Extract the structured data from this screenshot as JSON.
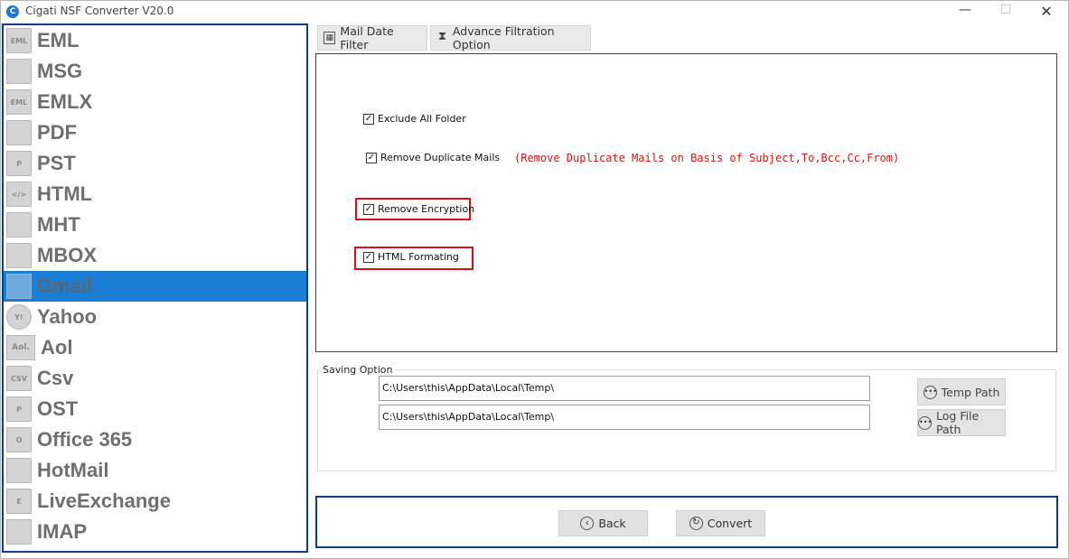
{
  "window": {
    "title": "Cigati NSF Converter V20.0",
    "app_icon_letter": "C",
    "minimize": "—",
    "maximize": "☐",
    "close": "✕"
  },
  "sidebar": {
    "selected_index": 8,
    "items": [
      {
        "label": "EML",
        "icon": "eml-file-icon",
        "glyph": "EML"
      },
      {
        "label": "MSG",
        "icon": "msg-envelope-icon",
        "glyph": ""
      },
      {
        "label": "EMLX",
        "icon": "emlx-file-icon",
        "glyph": "EML"
      },
      {
        "label": "PDF",
        "icon": "pdf-file-icon",
        "glyph": ""
      },
      {
        "label": "PST",
        "icon": "pst-file-icon",
        "glyph": "P"
      },
      {
        "label": "HTML",
        "icon": "html-file-icon",
        "glyph": "</>"
      },
      {
        "label": "MHT",
        "icon": "mht-file-icon",
        "glyph": ""
      },
      {
        "label": "MBOX",
        "icon": "mbox-envelope-icon",
        "glyph": ""
      },
      {
        "label": "Gmail",
        "icon": "gmail-icon",
        "glyph": ""
      },
      {
        "label": "Yahoo",
        "icon": "yahoo-icon",
        "glyph": "Y!"
      },
      {
        "label": "Aol",
        "icon": "aol-icon",
        "glyph": "Aol."
      },
      {
        "label": "Csv",
        "icon": "csv-file-icon",
        "glyph": "CSV"
      },
      {
        "label": "OST",
        "icon": "ost-file-icon",
        "glyph": "P"
      },
      {
        "label": "Office 365",
        "icon": "office365-icon",
        "glyph": "O"
      },
      {
        "label": "HotMail",
        "icon": "hotmail-icon",
        "glyph": ""
      },
      {
        "label": "LiveExchange",
        "icon": "exchange-icon",
        "glyph": "E"
      },
      {
        "label": "IMAP",
        "icon": "imap-icon",
        "glyph": ""
      }
    ]
  },
  "tabs": [
    {
      "label": "Mail Date Filter",
      "icon": "calendar-icon",
      "glyph": "▦"
    },
    {
      "label": "Advance Filtration Option",
      "icon": "hourglass-icon",
      "glyph": "⧗"
    }
  ],
  "options": {
    "exclude_all_folder": {
      "label": "Exclude All Folder",
      "checked": "✓"
    },
    "remove_duplicate_mails": {
      "label": "Remove Duplicate Mails",
      "checked": "✓"
    },
    "duplicate_note": "(Remove Duplicate Mails on  Basis of Subject,To,Bcc,Cc,From)",
    "remove_encryption": {
      "label": "Remove Encryption",
      "checked": "✓"
    },
    "html_formating": {
      "label": "HTML Formating",
      "checked": "✓"
    },
    "highlight_color": "#e01010"
  },
  "saving_option": {
    "legend": "Saving Option",
    "temp_path_value": "C:\\Users\\this\\AppData\\Local\\Temp\\",
    "log_path_value": "C:\\Users\\this\\AppData\\Local\\Temp\\",
    "temp_path_button": "Temp Path",
    "log_file_path_button": "Log File Path"
  },
  "actions": {
    "back": "Back",
    "convert": "Convert"
  },
  "colors": {
    "accent_border": "#0b3f8c",
    "selected_bg": "#1a7fd4"
  }
}
